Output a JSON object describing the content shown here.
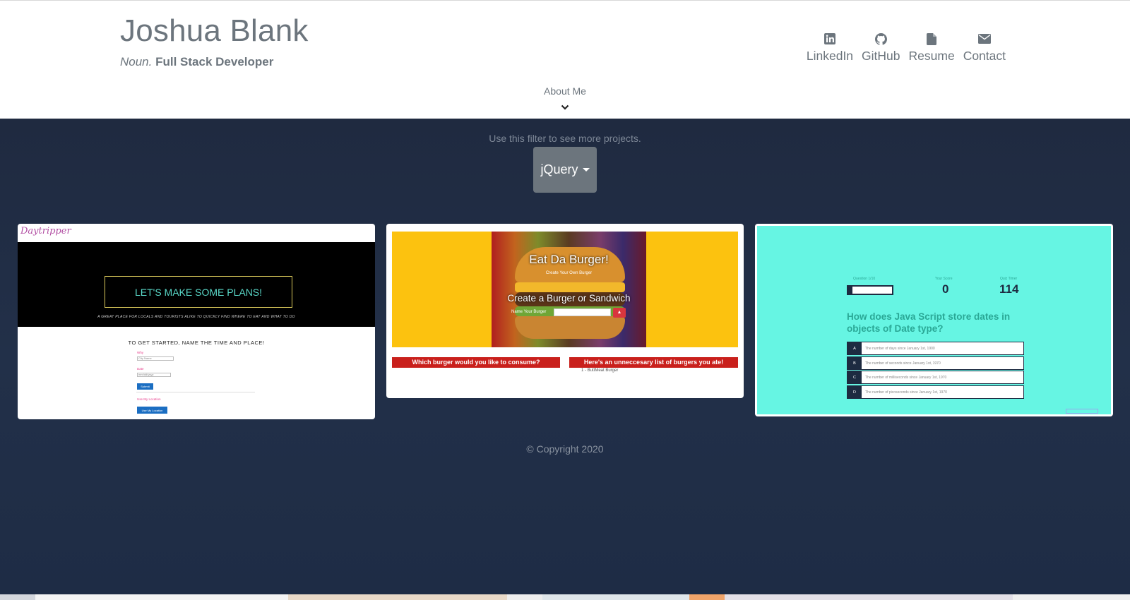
{
  "header": {
    "name": "Joshua Blank",
    "tagline_noun": "Noun.",
    "tagline_role": "Full Stack Developer",
    "nav": [
      {
        "label": "LinkedIn",
        "icon": "linkedin-icon"
      },
      {
        "label": "GitHub",
        "icon": "github-icon"
      },
      {
        "label": "Resume",
        "icon": "file-icon"
      },
      {
        "label": "Contact",
        "icon": "envelope-icon"
      }
    ],
    "about_label": "About Me"
  },
  "main": {
    "filter_hint": "Use this filter to see more projects.",
    "filter_value": "jQuery",
    "copyright": "© Copyright 2020"
  },
  "projects": {
    "daytripper": {
      "logo": "Daytripper",
      "hero_button": "LET'S MAKE SOME PLANS!",
      "hero_sub": "A GREAT PLACE FOR LOCALS AND TOURISTS ALIKE TO QUICKLY FIND WHERE TO EAT AND WHAT TO DO",
      "form_title": "TO GET STARTED, NAME THE TIME AND PLACE!",
      "where_label": "Why",
      "where_placeholder": "City Name",
      "date_label": "Date",
      "date_placeholder": "mm/dd/yyyy",
      "submit": "Submit",
      "alt_label": "Use My Location",
      "location_button": "Use My Location"
    },
    "burger": {
      "title": "Eat Da Burger!",
      "subtitle": "Create Your Own Burger",
      "create": "Create a Burger or Sandwich",
      "name_label": "Name Your Burger",
      "left_bar": "Which burger would you like to consume?",
      "right_bar": "Here's an unneccesary list of burgers you ate!",
      "list_item": "1 - ButtMeat Burger"
    },
    "quiz": {
      "question_label": "Question 1/10",
      "score_label": "Your Score",
      "score": "0",
      "timer_label": "Quiz Timer",
      "timer": "114",
      "progress": 0.1,
      "question": "How does Java Script store dates in objects of Date type?",
      "answers": [
        {
          "letter": "A",
          "text": "The number of days since January 1st, 1900"
        },
        {
          "letter": "B",
          "text": "The number of seconds since January 1st, 1970"
        },
        {
          "letter": "C",
          "text": "The number of milliseconds since January 1st, 1970"
        },
        {
          "letter": "D",
          "text": "The number of picoseconds since January 1st, 1970"
        }
      ]
    }
  },
  "colors": {
    "header_text": "#6c757d",
    "main_bg": "#1f2a40",
    "dropdown_bg": "#6c757d",
    "quiz_bg": "#66f5e3",
    "burger_yellow": "#fcc20f",
    "burger_red": "#c9201c"
  }
}
